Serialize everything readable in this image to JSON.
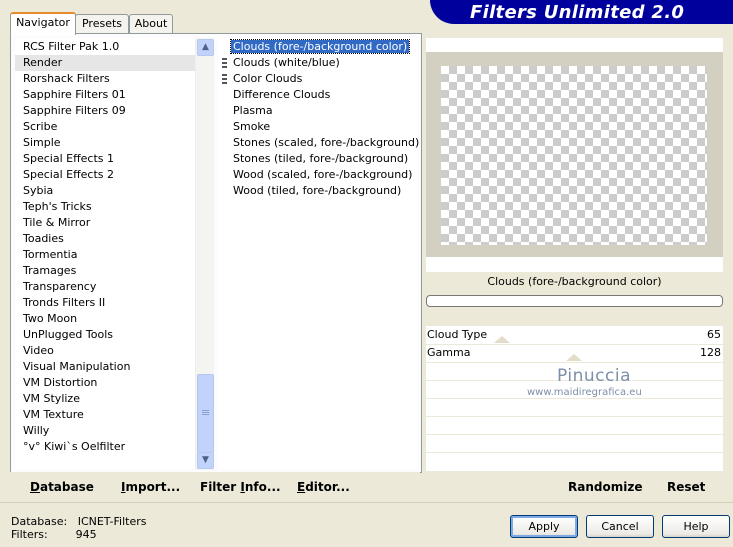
{
  "tabs": [
    "Navigator",
    "Presets",
    "About"
  ],
  "banner_title": "Filters Unlimited 2.0",
  "categories": [
    "RCS Filter Pak 1.0",
    "Render",
    "Rorshack Filters",
    "Sapphire Filters 01",
    "Sapphire Filters 09",
    "Scribe",
    "Simple",
    "Special Effects 1",
    "Special Effects 2",
    "Sybia",
    "Teph's Tricks",
    "Tile & Mirror",
    "Toadies",
    "Tormentia",
    "Tramages",
    "Transparency",
    "Tronds Filters II",
    "Two Moon",
    "UnPlugged Tools",
    "Video",
    "Visual Manipulation",
    "VM Distortion",
    "VM Stylize",
    "VM Texture",
    "Willy",
    "°v° Kiwi`s Oelfilter"
  ],
  "selected_category": "Render",
  "filters": [
    "Clouds (fore-/background color)",
    "Clouds (white/blue)",
    "Color Clouds",
    "Difference Clouds",
    "Plasma",
    "Smoke",
    "Stones (scaled, fore-/background)",
    "Stones (tiled, fore-/background)",
    "Wood (scaled, fore-/background)",
    "Wood (tiled, fore-/background)"
  ],
  "selected_filter": "Clouds (fore-/background color)",
  "filter_icons": [
    false,
    true,
    true,
    false,
    false,
    false,
    false,
    false,
    false,
    false
  ],
  "preview_title": "Clouds (fore-/background color)",
  "params": [
    {
      "label": "Cloud Type",
      "value": "65"
    },
    {
      "label": "Gamma",
      "value": "128"
    }
  ],
  "watermark": {
    "name": "Pinuccia",
    "site": "www.maidiregrafica.eu"
  },
  "left_buttons": [
    {
      "underline": "D",
      "rest": "atabase"
    },
    {
      "underline": "I",
      "rest": "mport..."
    },
    {
      "pre": "Filter ",
      "underline": "I",
      "rest": "nfo..."
    },
    {
      "underline": "E",
      "rest": "ditor..."
    }
  ],
  "randomize_label": "Randomize",
  "reset_label": "Reset",
  "status": {
    "database_label": "Database:",
    "database_value": "ICNET-Filters",
    "filters_label": "Filters:",
    "filters_value": "945"
  },
  "buttons": {
    "apply": "Apply",
    "cancel": "Cancel",
    "help": "Help"
  },
  "colors": {
    "banner": "#00009c",
    "selection": "#316ac5",
    "tab_accent": "#e68b2c"
  }
}
